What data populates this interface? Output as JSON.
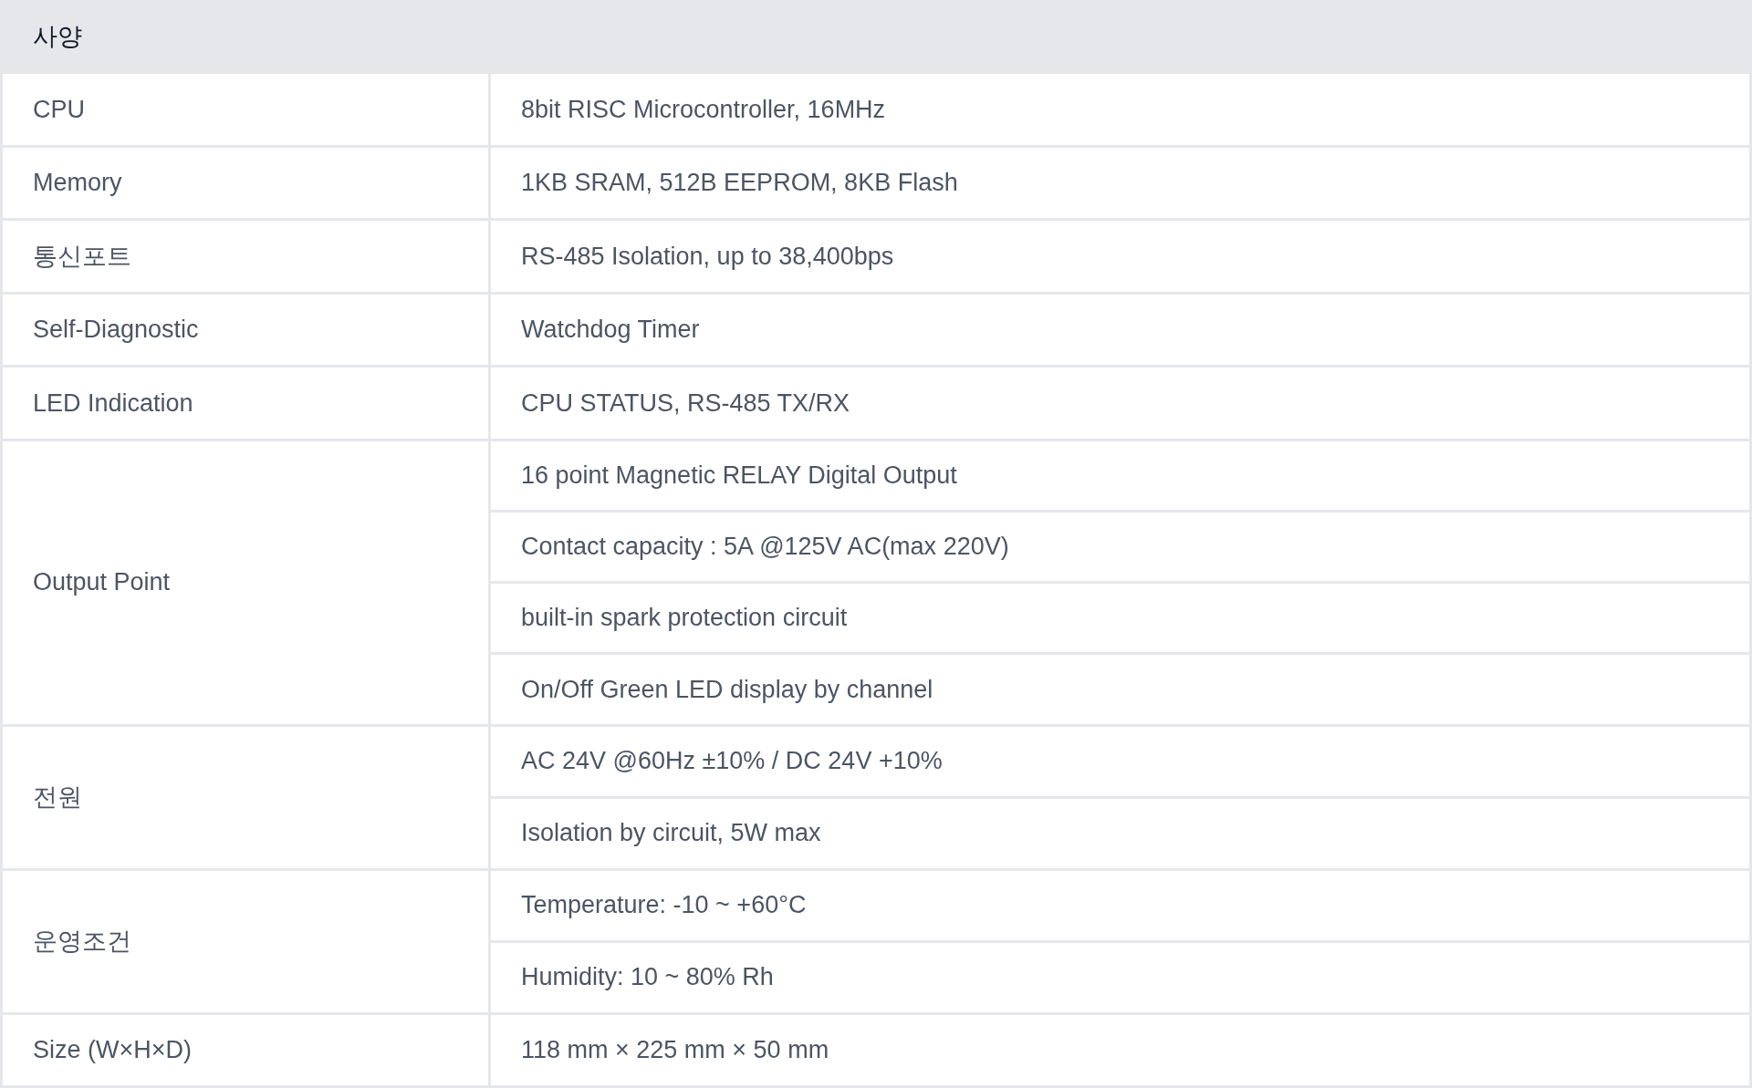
{
  "title": "사양",
  "rows": [
    {
      "label": "CPU",
      "values": [
        "8bit RISC Microcontroller, 16MHz"
      ]
    },
    {
      "label": "Memory",
      "values": [
        "1KB SRAM, 512B EEPROM, 8KB Flash"
      ]
    },
    {
      "label": "통신포트",
      "values": [
        "RS-485 Isolation, up to 38,400bps"
      ]
    },
    {
      "label": "Self-Diagnostic",
      "values": [
        "Watchdog Timer"
      ]
    },
    {
      "label": "LED Indication",
      "values": [
        "CPU STATUS, RS-485 TX/RX"
      ]
    },
    {
      "label": "Output Point",
      "values": [
        "16 point Magnetic RELAY Digital Output",
        "Contact capacity : 5A @125V AC(max 220V)",
        "built-in spark protection circuit",
        "On/Off Green LED display by channel"
      ]
    },
    {
      "label": "전원",
      "values": [
        "AC 24V @60Hz ±10% / DC 24V +10%",
        "Isolation by circuit, 5W max"
      ]
    },
    {
      "label": "운영조건",
      "values": [
        "Temperature: -10 ~ +60°C",
        "Humidity: 10 ~ 80% Rh"
      ]
    },
    {
      "label": "Size (W×H×D)",
      "values": [
        "118 mm × 225 mm × 50 mm"
      ]
    }
  ]
}
